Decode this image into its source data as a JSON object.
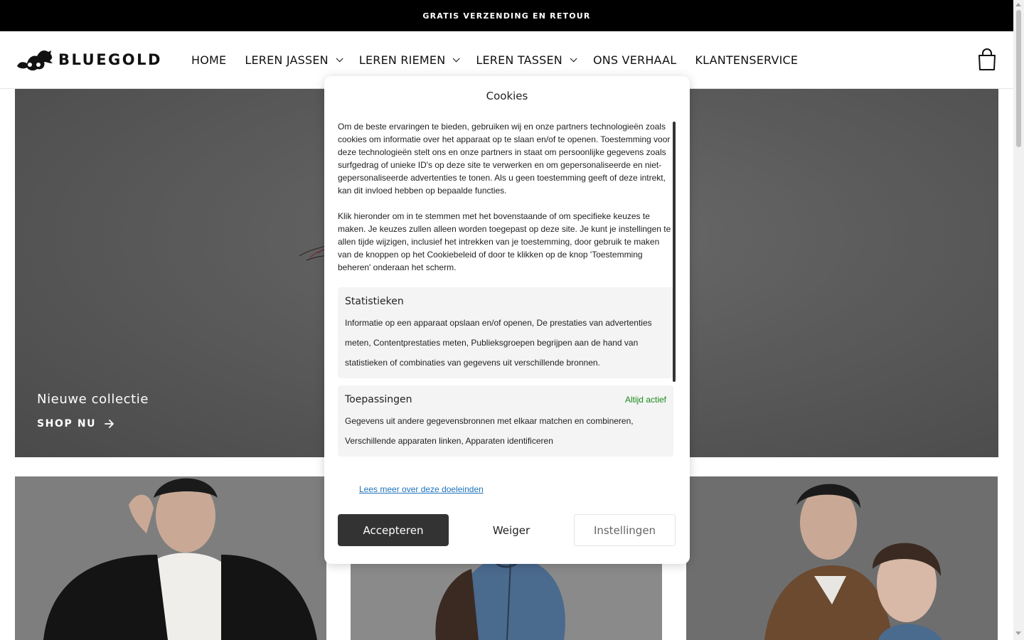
{
  "announcement": {
    "text": "GRATIS VERZENDING EN RETOUR"
  },
  "header": {
    "logo_text": "BLUEGOLD",
    "nav": [
      {
        "label": "HOME",
        "has_dropdown": false
      },
      {
        "label": "LEREN JASSEN",
        "has_dropdown": true
      },
      {
        "label": "LEREN RIEMEN",
        "has_dropdown": true
      },
      {
        "label": "LEREN TASSEN",
        "has_dropdown": true
      },
      {
        "label": "ONS VERHAAL",
        "has_dropdown": false
      },
      {
        "label": "KLANTENSERVICE",
        "has_dropdown": false
      }
    ],
    "cart_icon": "shopping-bag-icon"
  },
  "hero": {
    "title": "Nieuwe collectie",
    "cta": "SHOP NU"
  },
  "cookie_modal": {
    "title": "Cookies",
    "paragraph_1": "Om de beste ervaringen te bieden, gebruiken wij en onze partners technologieën zoals cookies om informatie over het apparaat op te slaan en/of te openen. Toestemming voor deze technologieën stelt ons en onze partners in staat om persoonlijke gegevens zoals surfgedrag of unieke ID's op deze site te verwerken en om gepersonaliseerde en niet-gepersonaliseerde advertenties te tonen. Als u geen toestemming geeft of deze intrekt, kan dit invloed hebben op bepaalde functies.",
    "paragraph_2": "Klik hieronder om in te stemmen met het bovenstaande of om specifieke keuzes te maken. Je keuzes zullen alleen worden toegepast op deze site. Je kunt je instellingen te allen tijde wijzigen, inclusief het intrekken van je toestemming, door gebruik te maken van de knoppen op het Cookiebeleid of door te klikken op de knop 'Toestemming beheren' onderaan het scherm.",
    "sections": [
      {
        "title": "Statistieken",
        "text": "Informatie op een apparaat opslaan en/of openen, De prestaties van advertenties meten, Contentprestaties meten, Publieksgroepen begrijpen aan de hand van statistieken of combinaties van gegevens uit verschillende bronnen."
      },
      {
        "title": "Toepassingen",
        "badge": "Altijd actief",
        "text": "Gegevens uit andere gegevensbronnen met elkaar matchen en combineren, Verschillende apparaten linken, Apparaten identificeren"
      }
    ],
    "link": "Lees meer over deze doeleinden",
    "buttons": {
      "accept": "Accepteren",
      "deny": "Weiger",
      "settings": "Instellingen"
    }
  },
  "colors": {
    "announcement_bg": "#000000",
    "accept_button_bg": "#333333",
    "active_badge": "#1a8a1a",
    "link": "#1e73be"
  }
}
